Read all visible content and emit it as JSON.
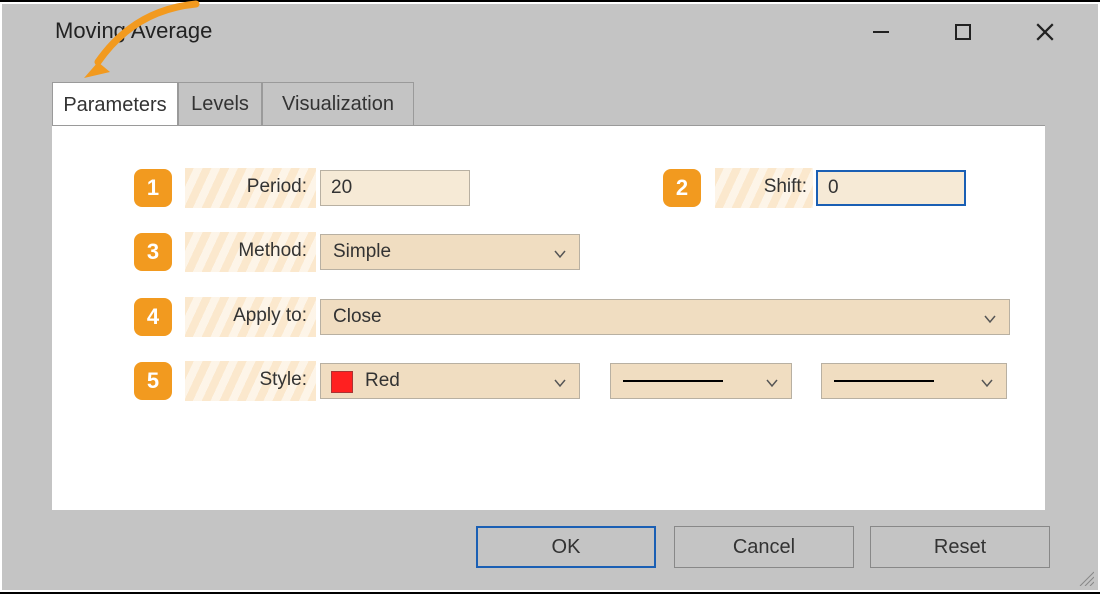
{
  "window": {
    "title": "Moving Average"
  },
  "tabs": {
    "parameters": "Parameters",
    "levels": "Levels",
    "visualization": "Visualization",
    "active": "parameters"
  },
  "annotations": {
    "n1": "1",
    "n2": "2",
    "n3": "3",
    "n4": "4",
    "n5": "5"
  },
  "labels": {
    "period": "Period:",
    "shift": "Shift:",
    "method": "Method:",
    "apply_to": "Apply to:",
    "style": "Style:"
  },
  "values": {
    "period": "20",
    "shift": "0",
    "method": "Simple",
    "apply_to": "Close",
    "color_name": "Red",
    "color_hex": "#ff2020"
  },
  "buttons": {
    "ok": "OK",
    "cancel": "Cancel",
    "reset": "Reset"
  }
}
